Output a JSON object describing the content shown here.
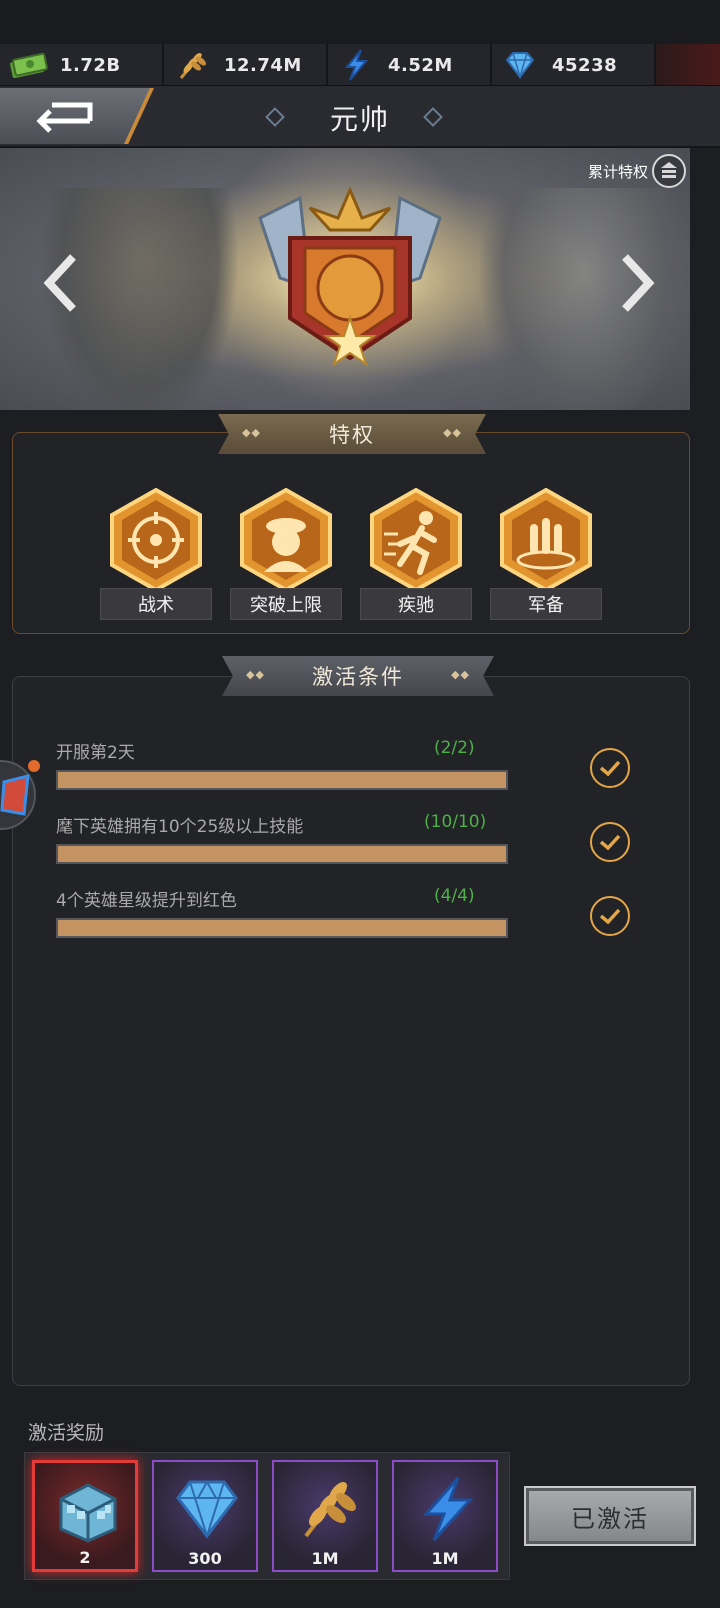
{
  "currencies": [
    {
      "icon": "cash-icon",
      "value": "1.72B"
    },
    {
      "icon": "wheat-icon",
      "value": "12.74M"
    },
    {
      "icon": "lightning-icon",
      "value": "4.52M"
    },
    {
      "icon": "diamond-icon",
      "value": "45238"
    }
  ],
  "header": {
    "title": "元帅"
  },
  "banner": {
    "cumulative_label": "累计特权"
  },
  "privileges": {
    "title": "特权",
    "items": [
      {
        "label": "战术",
        "icon": "crosshair-icon"
      },
      {
        "label": "突破上限",
        "icon": "soldier-icon"
      },
      {
        "label": "疾驰",
        "icon": "running-icon"
      },
      {
        "label": "军备",
        "icon": "ammo-icon"
      }
    ]
  },
  "conditions": {
    "title": "激活条件",
    "items": [
      {
        "text": "开服第2天",
        "progress_text": "(2/2)",
        "progress": 1.0
      },
      {
        "text": "麾下英雄拥有10个25级以上技能",
        "progress_text": "(10/10)",
        "progress": 1.0
      },
      {
        "text": "4个英雄星级提升到红色",
        "progress_text": "(4/4)",
        "progress": 1.0
      }
    ]
  },
  "rewards": {
    "title": "激活奖励",
    "items": [
      {
        "icon": "crate-icon",
        "count": "2"
      },
      {
        "icon": "diamond-icon",
        "count": "300"
      },
      {
        "icon": "wheat-icon",
        "count": "1M"
      },
      {
        "icon": "lightning-icon",
        "count": "1M"
      }
    ],
    "button_label": "已激活"
  },
  "colors": {
    "accent_gold": "#e4a646",
    "progress_green": "#4fb04a",
    "progress_fill": "#c39461"
  }
}
